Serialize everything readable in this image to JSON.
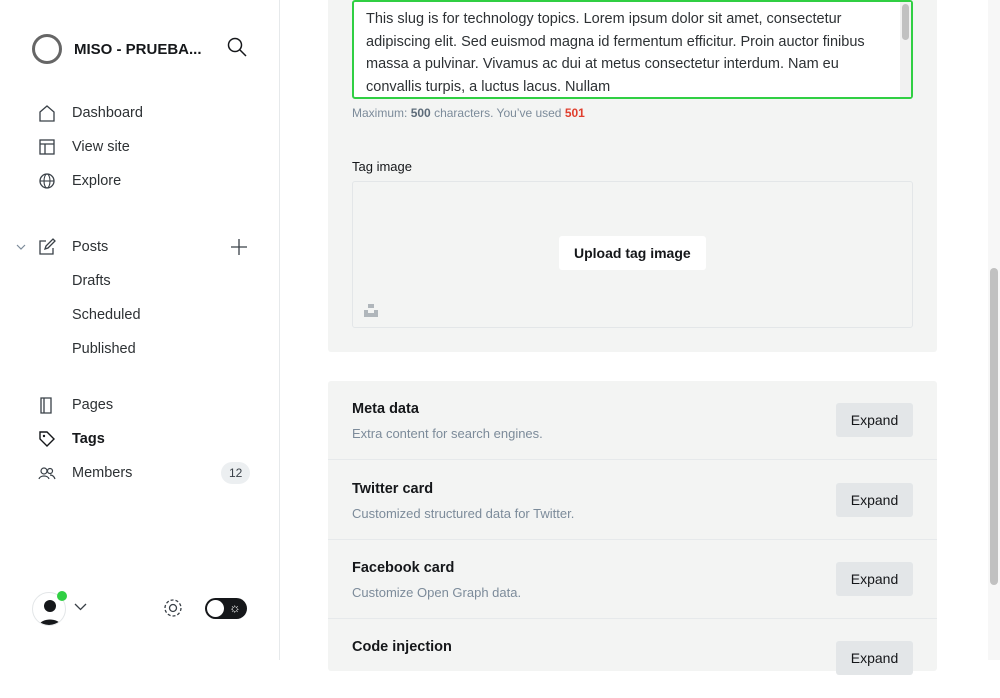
{
  "sidebar": {
    "site_title": "MISO - PRUEBA...",
    "items": [
      {
        "label": "Dashboard",
        "icon": "home-icon"
      },
      {
        "label": "View site",
        "icon": "layout-icon"
      },
      {
        "label": "Explore",
        "icon": "globe-icon"
      },
      {
        "label": "Posts",
        "icon": "edit-icon"
      },
      {
        "label": "Drafts"
      },
      {
        "label": "Scheduled"
      },
      {
        "label": "Published"
      },
      {
        "label": "Pages",
        "icon": "page-icon"
      },
      {
        "label": "Tags",
        "icon": "tag-icon"
      },
      {
        "label": "Members",
        "icon": "members-icon",
        "count": "12"
      }
    ],
    "active": "Tags"
  },
  "form": {
    "description": "This slug is for technology topics. Lorem ipsum dolor sit amet, consectetur adipiscing elit. Sed euismod magna id fermentum efficitur. Proin auctor finibus massa a pulvinar. Vivamus ac dui at metus consectetur interdum. Nam eu convallis turpis, a luctus lacus. Nullam",
    "hint_prefix": "Maximum:",
    "max": "500",
    "hint_mid": "characters. You’ve used",
    "used": "501",
    "tag_image_label": "Tag image",
    "upload_label": "Upload tag image"
  },
  "sections": [
    {
      "title": "Meta data",
      "desc": "Extra content for search engines.",
      "button": "Expand"
    },
    {
      "title": "Twitter card",
      "desc": "Customized structured data for Twitter.",
      "button": "Expand"
    },
    {
      "title": "Facebook card",
      "desc": "Customize Open Graph data.",
      "button": "Expand"
    },
    {
      "title": "Code injection",
      "desc": "",
      "button": "Expand"
    }
  ],
  "colors": {
    "accent": "#30cf43",
    "error": "#e03e2d"
  }
}
